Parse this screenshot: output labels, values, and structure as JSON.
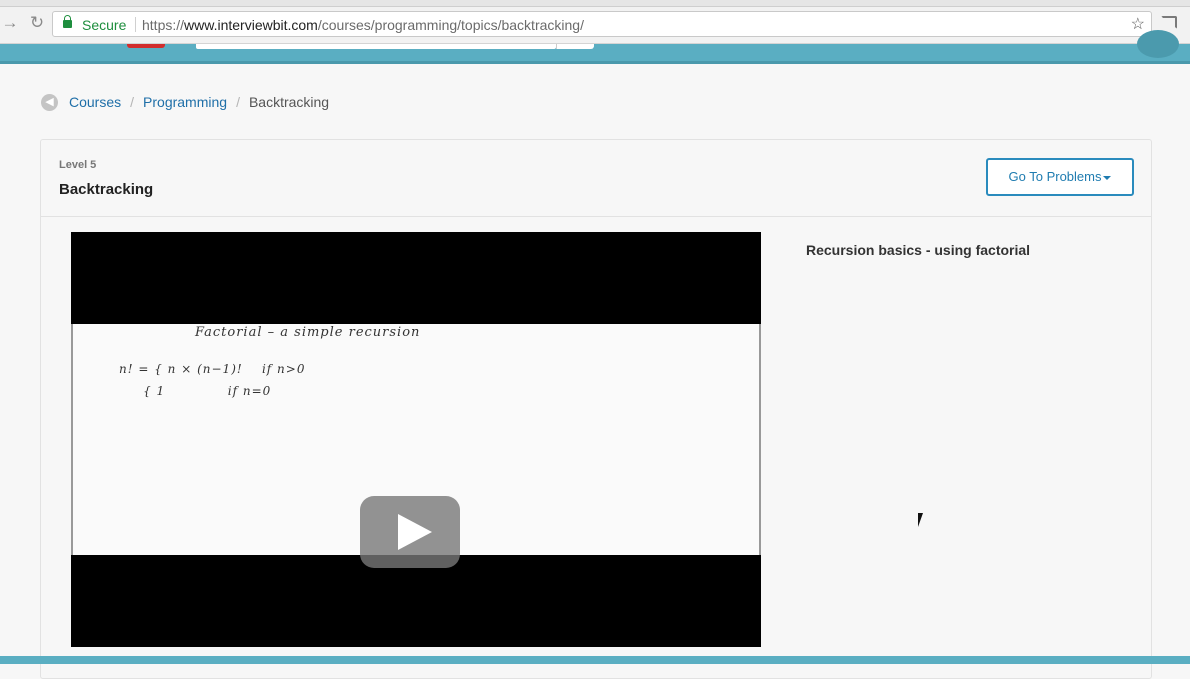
{
  "browser": {
    "secure_label": "Secure",
    "url_scheme": "https://",
    "url_host": "www.interviewbit.com",
    "url_path": "/courses/programming/topics/backtracking/"
  },
  "breadcrumb": {
    "items": [
      {
        "label": "Courses"
      },
      {
        "label": "Programming"
      },
      {
        "label": "Backtracking"
      }
    ],
    "separator": "/"
  },
  "topic": {
    "level": "Level 5",
    "title": "Backtracking",
    "go_to_problems_label": "Go To Problems"
  },
  "video": {
    "whiteboard_title": "Factorial – a simple recursion",
    "line1": "n! = { n × (n−1)!    if n>0",
    "line2": "     { 1             if n=0",
    "caption": "Recursion basics - using factorial"
  },
  "icons": {
    "back": "arrow-left-circle-icon",
    "lock": "lock-icon",
    "star": "star-icon",
    "cast": "cast-icon",
    "play": "play-icon",
    "caret": "caret-down-icon"
  },
  "colors": {
    "header_teal": "#5aaec2",
    "link_blue": "#1f6fa8",
    "button_blue": "#2a8bbd",
    "secure_green": "#1e8e3e",
    "logo_red": "#d22d2d"
  }
}
